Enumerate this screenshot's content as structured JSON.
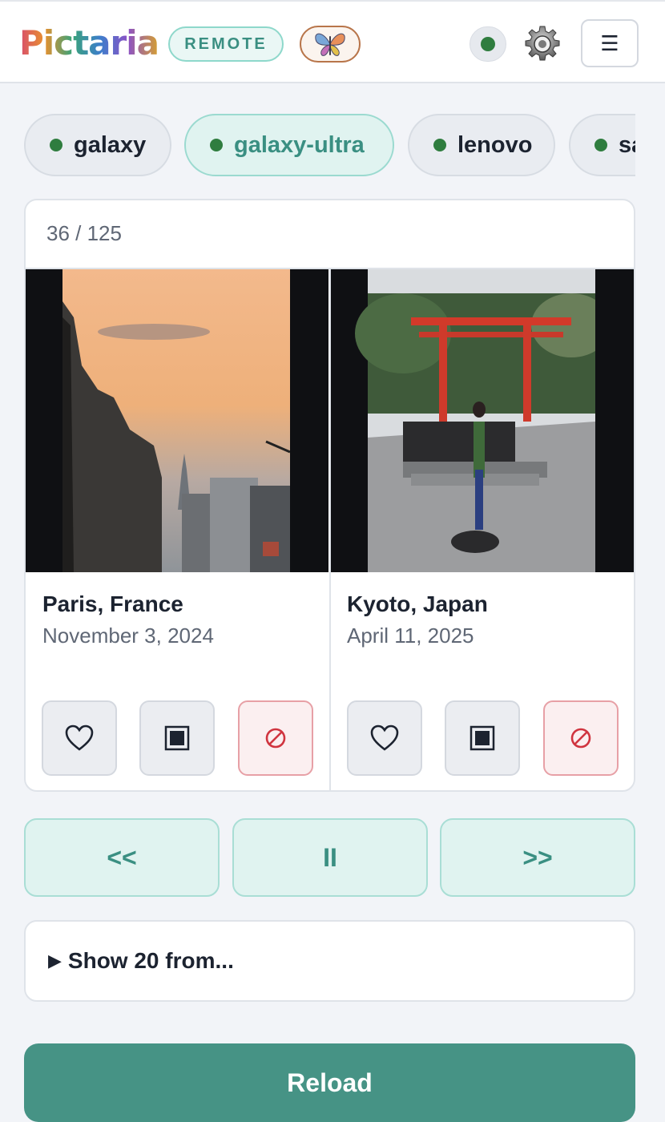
{
  "header": {
    "app_name": "Pictaria",
    "mode_badge": "REMOTE",
    "menu_icon": "☰"
  },
  "icons": {
    "butterfly": "butterfly-icon",
    "status": "status-dot-icon",
    "settings": "gear-icon",
    "menu": "hamburger-menu-icon",
    "like": "heart-icon",
    "frame": "frame-icon",
    "block": "block-icon"
  },
  "colors": {
    "accent": "#469385",
    "accent_light": "#e0f3f0",
    "status_online": "#2f7d3f",
    "danger": "#d0343f"
  },
  "devices": [
    {
      "label": "galaxy",
      "active": false
    },
    {
      "label": "galaxy-ultra",
      "active": true
    },
    {
      "label": "lenovo",
      "active": false
    },
    {
      "label": "samsung",
      "active": false
    }
  ],
  "viewer": {
    "counter": "36 / 125",
    "photos": [
      {
        "title": "Paris, France",
        "date": "November 3, 2024"
      },
      {
        "title": "Kyoto, Japan",
        "date": "April 11, 2025"
      }
    ]
  },
  "nav": {
    "prev": "<<",
    "pause": "II",
    "next": ">>"
  },
  "show_from": {
    "marker": "▶",
    "label": "Show 20 from..."
  },
  "reload_label": "Reload"
}
